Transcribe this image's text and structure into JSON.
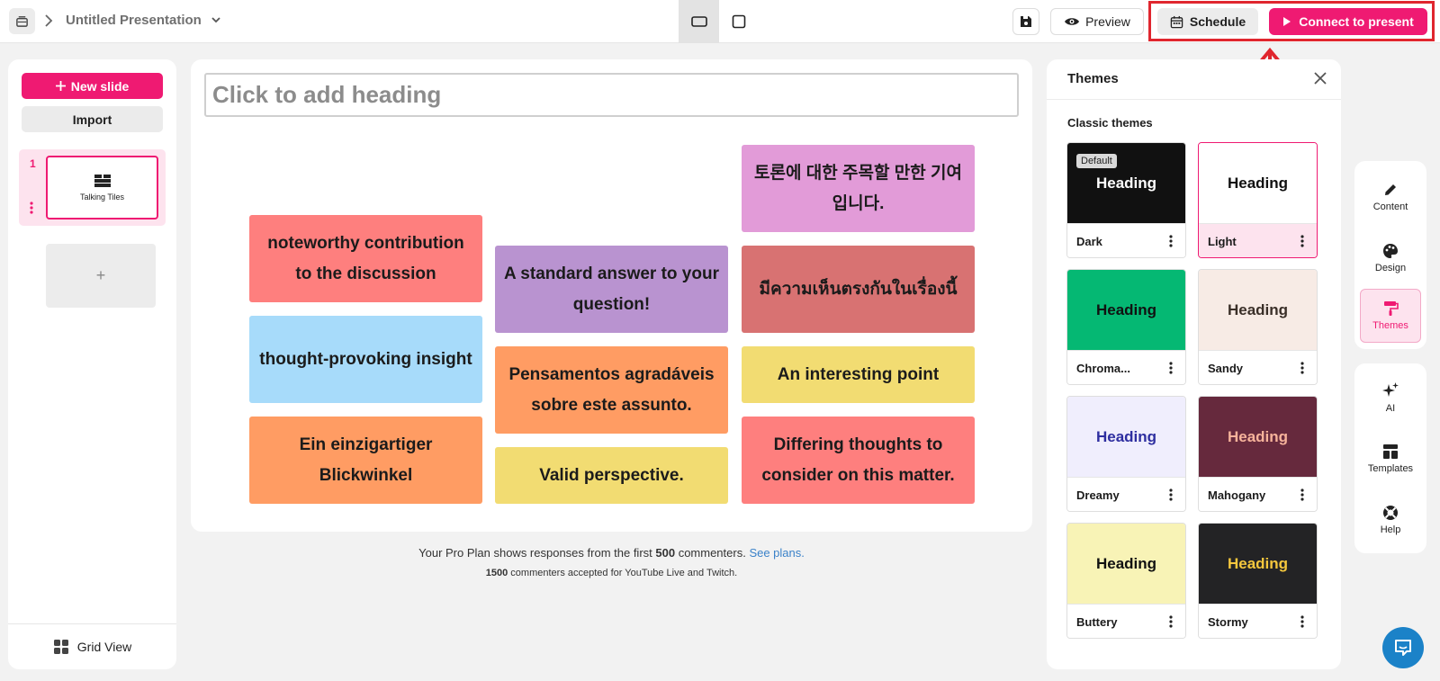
{
  "topbar": {
    "title": "Untitled Presentation",
    "preview_label": "Preview",
    "schedule_label": "Schedule",
    "connect_label": "Connect to present"
  },
  "left": {
    "new_slide_label": "New slide",
    "import_label": "Import",
    "slides": [
      {
        "number": "1",
        "label": "Talking Tiles"
      }
    ],
    "add_label": "+",
    "grid_view_label": "Grid View"
  },
  "canvas": {
    "heading_placeholder": "Click to add heading",
    "tiles": [
      {
        "text": "토론에 대한 주목할 만한 기여입니다.",
        "color": "#e29bd8"
      },
      {
        "text": "noteworthy contribution to the discussion",
        "color": "#fe7f7e"
      },
      {
        "text": "A standard answer to your question!",
        "color": "#b993d0"
      },
      {
        "text": "มีความเห็นตรงกันในเรื่องนี้",
        "color": "#d87272"
      },
      {
        "text": "thought-provoking insight",
        "color": "#a7dbfa"
      },
      {
        "text": "Pensamentos agradáveis sobre este assunto.",
        "color": "#ff9c63"
      },
      {
        "text": "An interesting point",
        "color": "#f2dc72"
      },
      {
        "text": "Ein einzigartiger Blickwinkel",
        "color": "#ff9c63"
      },
      {
        "text": "Valid perspective.",
        "color": "#f2dc72"
      },
      {
        "text": "Differing thoughts to consider on this matter.",
        "color": "#fe7f7e"
      }
    ]
  },
  "footer": {
    "line1_pre": "Your Pro Plan shows responses from the first ",
    "line1_num": "500",
    "line1_post": " commenters. ",
    "line1_link": "See plans.",
    "line2_num": "1500",
    "line2_post": " commenters accepted for YouTube Live and Twitch."
  },
  "themes": {
    "title": "Themes",
    "section": "Classic themes",
    "default_badge": "Default",
    "cards": [
      {
        "name": "Dark",
        "heading": "Heading",
        "bg": "#111111",
        "fg": "#ffffff"
      },
      {
        "name": "Light",
        "heading": "Heading",
        "bg": "#ffffff",
        "fg": "#111111"
      },
      {
        "name": "Chroma...",
        "heading": "Heading",
        "bg": "#05b873",
        "fg": "#111111"
      },
      {
        "name": "Sandy",
        "heading": "Heading",
        "bg": "#f7ebe5",
        "fg": "#3a2f28"
      },
      {
        "name": "Dreamy",
        "heading": "Heading",
        "bg": "#f0eefd",
        "fg": "#2e2ea0"
      },
      {
        "name": "Mahogany",
        "heading": "Heading",
        "bg": "#66293d",
        "fg": "#f7b39b"
      },
      {
        "name": "Buttery",
        "heading": "Heading",
        "bg": "#f8f3b6",
        "fg": "#111111"
      },
      {
        "name": "Stormy",
        "heading": "Heading",
        "bg": "#232325",
        "fg": "#f5c73d"
      }
    ]
  },
  "rail": {
    "content": "Content",
    "design": "Design",
    "themes": "Themes",
    "ai": "AI",
    "templates": "Templates",
    "help": "Help"
  },
  "colors": {
    "accent": "#ef1a72",
    "highlight": "#e0262e"
  }
}
